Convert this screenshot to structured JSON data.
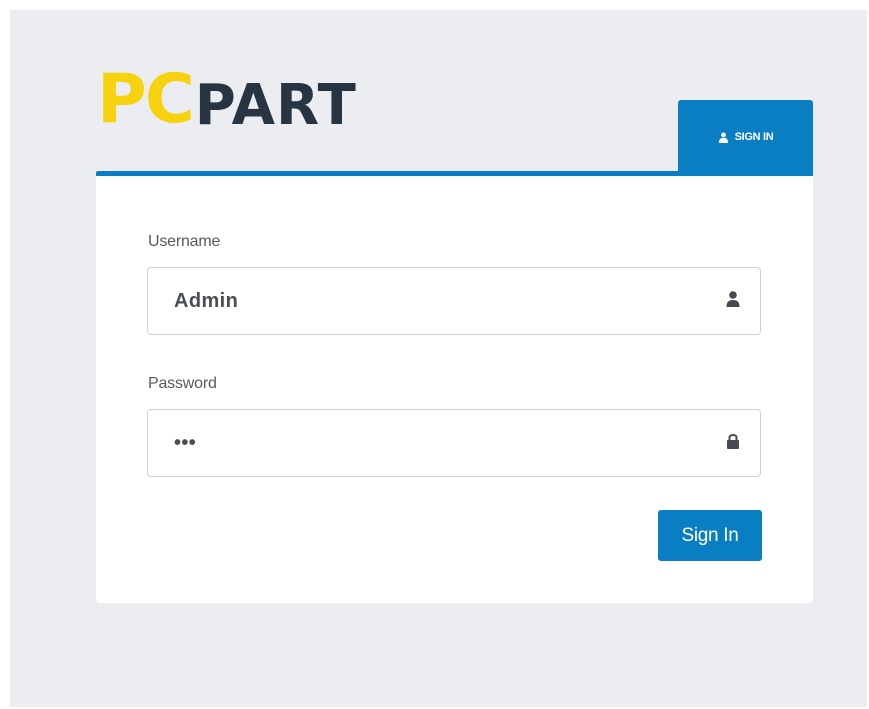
{
  "logo": {
    "part1": "PC",
    "part2": "PART",
    "part1_color": "#f6d20f",
    "part2_color": "#273542"
  },
  "tab": {
    "label": "SIGN IN",
    "icon": "user-icon"
  },
  "form": {
    "username": {
      "label": "Username",
      "value": "Admin",
      "icon": "user-icon"
    },
    "password": {
      "label": "Password",
      "value": "•••",
      "icon": "lock-icon"
    },
    "submit_label": "Sign In"
  },
  "colors": {
    "accent": "#0a7ec2",
    "background": "#ebedf0",
    "card": "#ffffff",
    "text": "#4b4f54",
    "label": "#555a60"
  }
}
